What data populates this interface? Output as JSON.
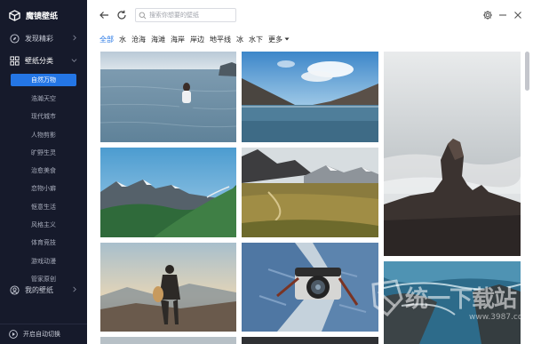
{
  "app": {
    "title": "魔镜壁纸"
  },
  "sidebar": {
    "discover_label": "发现精彩",
    "category_label": "壁纸分类",
    "categories": [
      {
        "label": "自然万物",
        "active": true
      },
      {
        "label": "浩瀚天空"
      },
      {
        "label": "现代城市"
      },
      {
        "label": "人物剪影"
      },
      {
        "label": "旷野生灵"
      },
      {
        "label": "治愈美食"
      },
      {
        "label": "恋物小癖"
      },
      {
        "label": "惬意生活"
      },
      {
        "label": "风格主义"
      },
      {
        "label": "体育竞技"
      },
      {
        "label": "游戏动漫"
      },
      {
        "label": "管家原创"
      }
    ],
    "mine_label": "我的壁纸",
    "auto_switch_label": "开启自动切换"
  },
  "topbar": {
    "search_placeholder": "搜索你想要的壁纸"
  },
  "tabs": {
    "items": [
      "全部",
      "水",
      "沧海",
      "海滩",
      "海岸",
      "岸边",
      "地平线",
      "冰",
      "水下"
    ],
    "active_index": 0,
    "more_label": "更多"
  },
  "watermark": {
    "text": "统一下载站",
    "url": "www.3987.com"
  },
  "scroll_position": 0.0,
  "icons": {
    "logo": "cube-logo-icon",
    "discover": "compass-icon",
    "category": "grid-icon",
    "mine": "user-icon",
    "auto_switch": "play-icon",
    "back": "arrow-left-icon",
    "refresh": "refresh-icon",
    "search": "search-icon",
    "settings": "gear-icon",
    "minimize": "minimize-icon",
    "close": "close-icon",
    "more": "caret-down-icon"
  },
  "colors": {
    "sidebar_bg": "#161a2b",
    "accent": "#2476e5",
    "active_tab": "#2476e5"
  }
}
